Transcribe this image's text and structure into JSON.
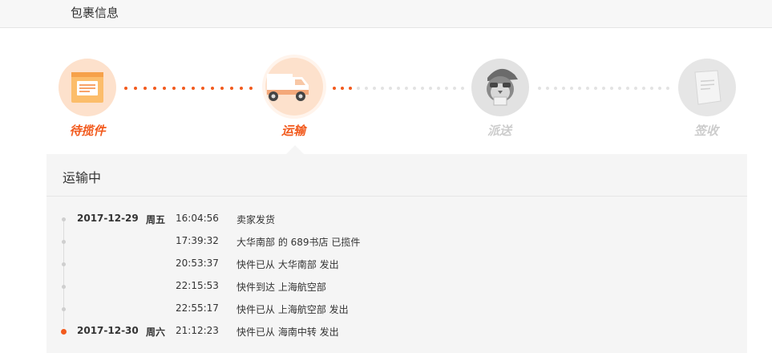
{
  "header": {
    "title": "包裹信息"
  },
  "steps": [
    {
      "label": "待揽件",
      "state": "done",
      "icon": "package-icon"
    },
    {
      "label": "运输",
      "state": "current",
      "icon": "truck-icon"
    },
    {
      "label": "派送",
      "state": "pending",
      "icon": "courier-icon"
    },
    {
      "label": "签收",
      "state": "pending",
      "icon": "document-icon"
    }
  ],
  "panel": {
    "title": "运输中"
  },
  "timeline": [
    {
      "date": "2017-12-29",
      "weekday": "周五",
      "time": "16:04:56",
      "desc": "卖家发货"
    },
    {
      "date": "",
      "weekday": "",
      "time": "17:39:32",
      "desc": "大华南部 的 689书店 已揽件"
    },
    {
      "date": "",
      "weekday": "",
      "time": "20:53:37",
      "desc": "快件已从 大华南部 发出"
    },
    {
      "date": "",
      "weekday": "",
      "time": "22:15:53",
      "desc": "快件到达 上海航空部"
    },
    {
      "date": "",
      "weekday": "",
      "time": "22:55:17",
      "desc": "快件已从 上海航空部 发出"
    },
    {
      "date": "2017-12-30",
      "weekday": "周六",
      "time": "21:12:23",
      "desc": "快件已从 海南中转 发出",
      "current": true
    }
  ],
  "colors": {
    "accent": "#f25a1d",
    "pending": "#cccccc",
    "panel": "#f5f5f5"
  }
}
